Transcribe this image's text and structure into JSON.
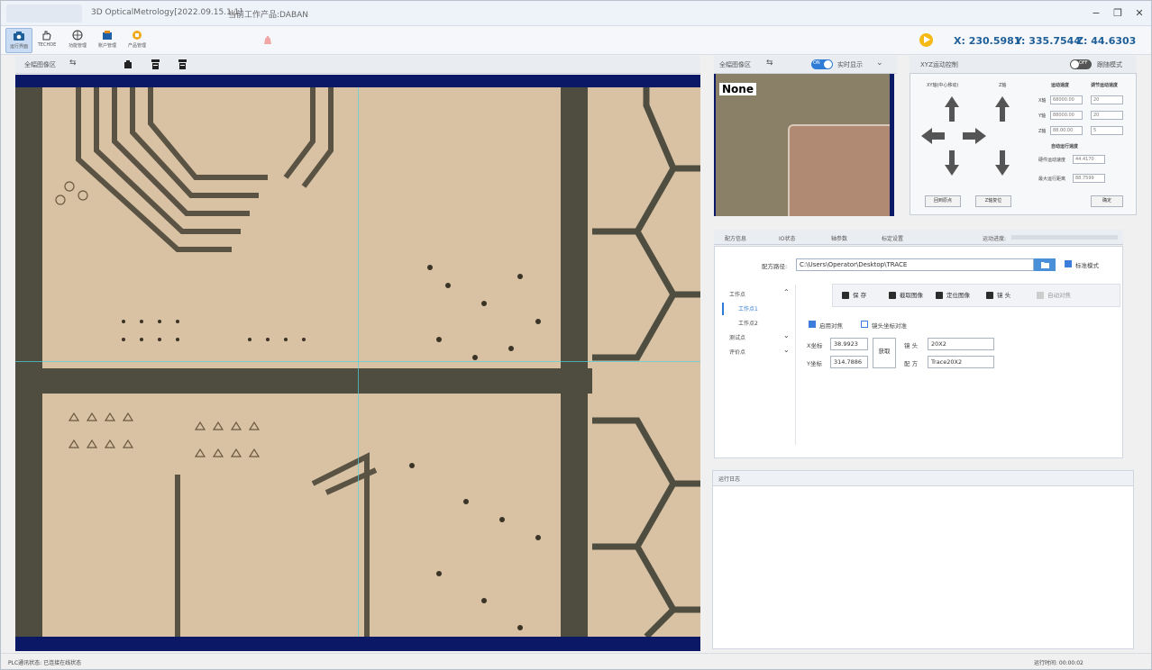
{
  "window": {
    "title": "3D OpticalMetrology[2022.09.15.1.1]",
    "subtitle": "当前工作产品:DABAN"
  },
  "toolbar": {
    "tools": [
      {
        "label": "运行界面",
        "icon": "camera-icon"
      },
      {
        "label": "TECHDE",
        "icon": "hand-icon"
      },
      {
        "label": "功能管理",
        "icon": "globe-icon"
      },
      {
        "label": "账户管理",
        "icon": "users-icon"
      },
      {
        "label": "产品管理",
        "icon": "box-icon"
      }
    ],
    "coords": {
      "x": "X: 230.5981",
      "y": "Y: 335.7544",
      "z": "Z: 44.6303"
    }
  },
  "image_panel": {
    "header": "全幅图像区",
    "swap_icon": "⇆"
  },
  "preview_panel": {
    "header": "全幅图像区",
    "toggle_label": "ON",
    "toggle_text": "实时显示",
    "overlay_label": "None"
  },
  "control_panel": {
    "header": "XYZ运动控制",
    "toggle_label": "OFF",
    "toggle_text": "跟随模式",
    "xy_label": "XY轴(中心移动)",
    "z_label": "Z轴",
    "speed_title": "运动速度",
    "speed_title2": "调节运动速度",
    "x_label": "X轴",
    "y_label": "Y轴",
    "z_axis_label": "Z轴",
    "x_value": "68000.00",
    "y_value": "88000.00",
    "z_value": "88.00.00",
    "x_step": "20",
    "y_step": "20",
    "z_step": "5",
    "auto_speed": "自动运行速度",
    "hiz_label": "硬件运动速度",
    "hiz_value": "44.4170",
    "dist_label": "最大运行距离",
    "dist_value": "88.7599",
    "btn1": "回到原点",
    "btn2": "Z轴复位",
    "btn3": "确定"
  },
  "tabs": [
    "配方信息",
    "IO状态",
    "轴参数",
    "标定设置"
  ],
  "progress_label": "运动进度:",
  "settings": {
    "path_label": "配方路径:",
    "path_value": "C:\\Users\\Operator\\Desktop\\TRACE",
    "std_mode": "标准模式",
    "tree": {
      "root": "工作点",
      "item1": "工作点1",
      "item2": "工作点2",
      "node2": "测试点",
      "node3": "评价点"
    },
    "buttons": [
      "保 存",
      "截取图像",
      "定位图像",
      "镜 头",
      "自动对焦"
    ],
    "auto_focus": "启用对焦",
    "cam_origin": "镜头坐标对准",
    "x_label": "X坐标",
    "x_value": "38.9923",
    "y_label": "Y坐标",
    "y_value": "314.7886",
    "capture_btn": "获取",
    "lens_label": "镜 头",
    "lens_value": "20X2",
    "recipe_label": "配 方",
    "recipe_value": "Trace20X2"
  },
  "log": {
    "header": "运行日志"
  },
  "status": {
    "left": "PLC通讯状态: 已连接在线状态",
    "right": "运行时间: 00:00:02"
  }
}
